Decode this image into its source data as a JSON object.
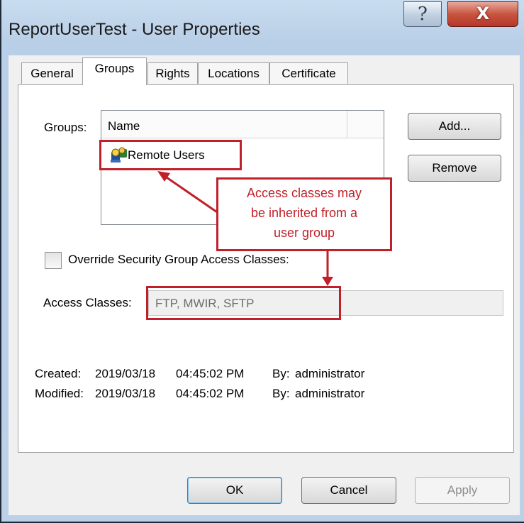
{
  "window": {
    "title": "ReportUserTest - User Properties",
    "help_glyph": "?",
    "close_glyph": "X"
  },
  "tabs": [
    {
      "label": "General",
      "active": false
    },
    {
      "label": "Groups",
      "active": true
    },
    {
      "label": "Rights",
      "active": false
    },
    {
      "label": "Locations",
      "active": false
    },
    {
      "label": "Certificate",
      "active": false
    }
  ],
  "groups": {
    "label": "Groups:",
    "column_header": "Name",
    "items": [
      {
        "name": "Remote Users",
        "icon": "user-group-icon"
      }
    ],
    "add_button": "Add...",
    "remove_button": "Remove"
  },
  "callout": {
    "lines": [
      "Access classes may",
      "be inherited from a",
      "user group"
    ]
  },
  "override": {
    "label": "Override Security Group Access Classes:",
    "checked": false
  },
  "access_classes": {
    "label": "Access Classes:",
    "value": "FTP, MWIR, SFTP"
  },
  "audit": {
    "created": {
      "label": "Created:",
      "date": "2019/03/18",
      "time": "04:45:02 PM",
      "by_label": "By:",
      "by": "administrator"
    },
    "modified": {
      "label": "Modified:",
      "date": "2019/03/18",
      "time": "04:45:02 PM",
      "by_label": "By:",
      "by": "administrator"
    }
  },
  "footer": {
    "ok": "OK",
    "cancel": "Cancel",
    "apply": "Apply"
  },
  "colors": {
    "highlight": "#c0202a",
    "titlebar": "#bcd1e8",
    "close_button": "#c8553f"
  }
}
